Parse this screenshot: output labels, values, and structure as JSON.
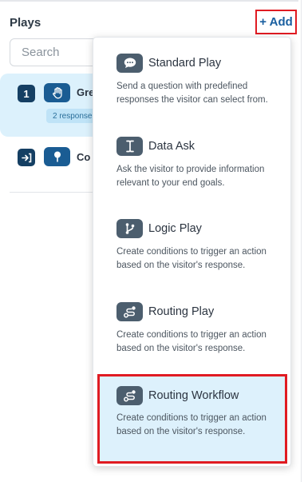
{
  "header": {
    "title": "Plays",
    "add_label": "+ Add"
  },
  "search": {
    "placeholder": "Search"
  },
  "plays": [
    {
      "number": "1",
      "icon": "hand-icon",
      "name_visible": "Gre",
      "badge": "2 response"
    },
    {
      "icon": "pin-icon",
      "name_visible": "Co"
    }
  ],
  "menu": {
    "items": [
      {
        "icon": "chat-bubble-icon",
        "title": "Standard Play",
        "description": "Send a question with predefined responses the visitor can select from."
      },
      {
        "icon": "text-cursor-icon",
        "title": "Data Ask",
        "description": "Ask the visitor to provide information relevant to your end goals."
      },
      {
        "icon": "branch-icon",
        "title": "Logic Play",
        "description": "Create conditions to trigger an action based on the visitor's response."
      },
      {
        "icon": "route-icon",
        "title": "Routing Play",
        "description": "Create conditions to trigger an action based on the visitor's response."
      },
      {
        "icon": "route-icon",
        "title": "Routing Workflow",
        "description": "Create conditions to trigger an action based on the visitor's response."
      }
    ]
  },
  "colors": {
    "accent": "#1a5fa0",
    "highlight_border": "#e01b22",
    "selected_bg": "#ddf1fc",
    "icon_bg": "#4c5e6e"
  }
}
